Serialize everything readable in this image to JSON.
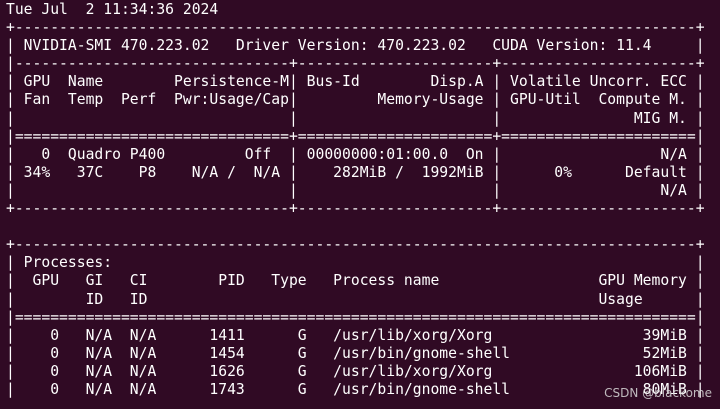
{
  "terminal": {
    "lines": [
      "Tue Jul  2 11:34:36 2024",
      "+-----------------------------------------------------------------------------+",
      "| NVIDIA-SMI 470.223.02   Driver Version: 470.223.02   CUDA Version: 11.4     |",
      "|-------------------------------+----------------------+----------------------+",
      "| GPU  Name        Persistence-M| Bus-Id        Disp.A | Volatile Uncorr. ECC |",
      "| Fan  Temp  Perf  Pwr:Usage/Cap|         Memory-Usage | GPU-Util  Compute M. |",
      "|                               |                      |               MIG M. |",
      "|===============================+======================+======================|",
      "|   0  Quadro P400         Off  | 00000000:01:00.0  On |                  N/A |",
      "| 34%   37C    P8    N/A /  N/A |    282MiB /  1992MiB |      0%      Default |",
      "|                               |                      |                  N/A |",
      "+-------------------------------+----------------------+----------------------+",
      "",
      "+-----------------------------------------------------------------------------+",
      "| Processes:                                                                  |",
      "|  GPU   GI   CI        PID   Type   Process name                  GPU Memory |",
      "|        ID   ID                                                   Usage      |",
      "|=============================================================================|",
      "|    0   N/A  N/A      1411      G   /usr/lib/xorg/Xorg                 39MiB |",
      "|    0   N/A  N/A      1454      G   /usr/bin/gnome-shell               52MiB |",
      "|    0   N/A  N/A      1626      G   /usr/lib/xorg/Xorg                106MiB |",
      "|    0   N/A  N/A      1743      G   /usr/bin/gnome-shell               80MiB |"
    ],
    "watermark": "CSDN @blackome"
  }
}
